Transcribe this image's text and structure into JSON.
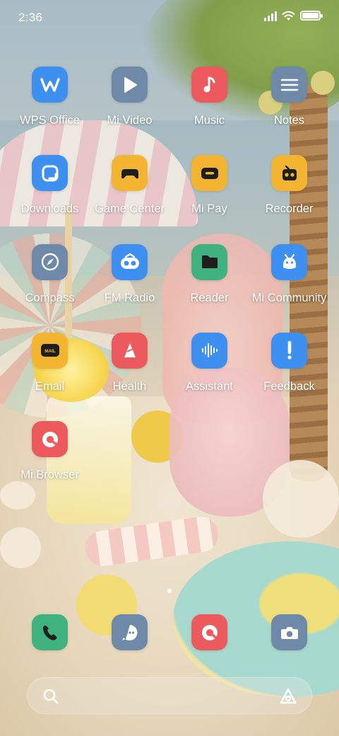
{
  "status_bar": {
    "time": "2:36",
    "icons": [
      "signal-icon",
      "wifi-icon",
      "battery-icon"
    ],
    "battery_level": 1.0
  },
  "apps": [
    {
      "label": "WPS Office",
      "icon": "wps-office-icon",
      "color": "#3d8ff0"
    },
    {
      "label": "Mi Video",
      "icon": "play-icon",
      "color": "#6f8aa8"
    },
    {
      "label": "Music",
      "icon": "music-note-icon",
      "color": "#ec5a5d"
    },
    {
      "label": "Notes",
      "icon": "notes-icon",
      "color": "#6f8aa8"
    },
    {
      "label": "Downloads",
      "icon": "downloads-icon",
      "color": "#3d8ff0"
    },
    {
      "label": "Game Center",
      "icon": "gamepad-icon",
      "color": "#f3b531"
    },
    {
      "label": "Mi Pay",
      "icon": "wallet-icon",
      "color": "#f3b531"
    },
    {
      "label": "Recorder",
      "icon": "recorder-icon",
      "color": "#f3b531"
    },
    {
      "label": "Compass",
      "icon": "compass-icon",
      "color": "#6f8aa8"
    },
    {
      "label": "FM Radio",
      "icon": "radio-icon",
      "color": "#3d8ff0"
    },
    {
      "label": "Reader",
      "icon": "book-icon",
      "color": "#3fb27f"
    },
    {
      "label": "Mi Community",
      "icon": "community-icon",
      "color": "#3d8ff0"
    },
    {
      "label": "Email",
      "icon": "mail-icon",
      "color": "#f3b531"
    },
    {
      "label": "Health",
      "icon": "health-icon",
      "color": "#ec5a5d"
    },
    {
      "label": "Assistant",
      "icon": "soundwave-icon",
      "color": "#3d8ff0"
    },
    {
      "label": "Feedback",
      "icon": "exclamation-icon",
      "color": "#3d8ff0"
    },
    {
      "label": "Mi Browser",
      "icon": "browser-icon",
      "color": "#ec5a5d"
    }
  ],
  "email_icon_text": "MAIL",
  "page_indicator": {
    "current": 1,
    "total": 1
  },
  "dock": [
    {
      "name": "phone",
      "icon": "phone-icon",
      "color": "#3fb27f"
    },
    {
      "name": "messages",
      "icon": "message-icon",
      "color": "#6f8aa8"
    },
    {
      "name": "browser",
      "icon": "browser-icon",
      "color": "#ec5a5d"
    },
    {
      "name": "camera",
      "icon": "camera-icon",
      "color": "#6f8aa8"
    }
  ],
  "search_bar": {
    "left_icon": "search-icon",
    "right_icon": "assistant-icon"
  }
}
